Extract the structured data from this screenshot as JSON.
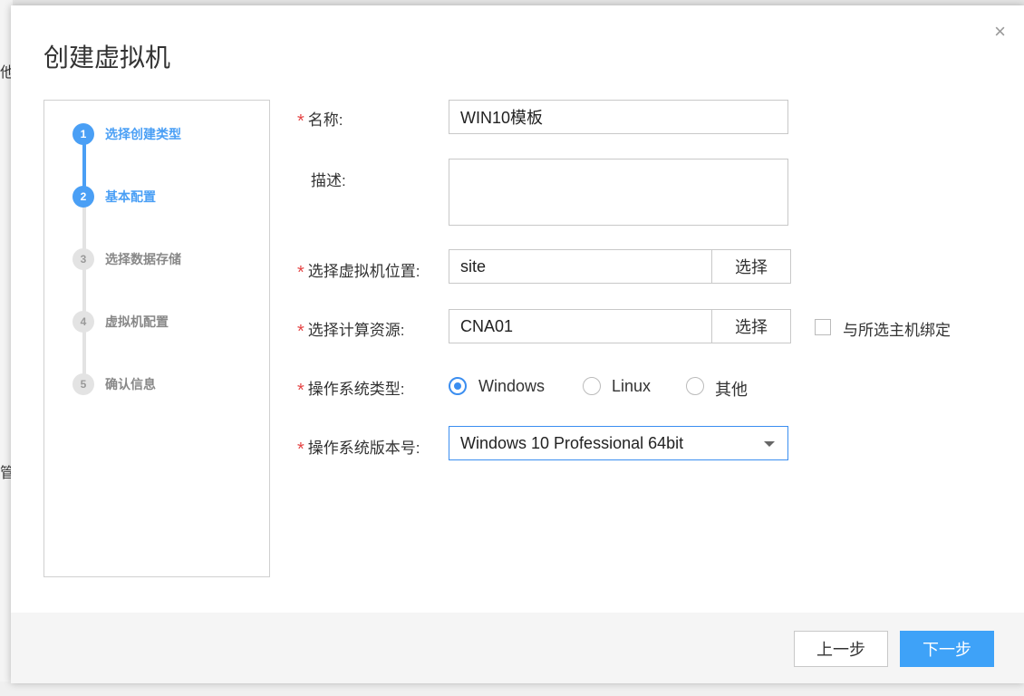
{
  "background": {
    "left_glyphs": [
      "他",
      "管"
    ]
  },
  "dialog": {
    "title": "创建虚拟机",
    "close_icon": "×"
  },
  "steps": [
    {
      "num": "1",
      "label": "选择创建类型",
      "state": "active"
    },
    {
      "num": "2",
      "label": "基本配置",
      "state": "active"
    },
    {
      "num": "3",
      "label": "选择数据存储",
      "state": "todo"
    },
    {
      "num": "4",
      "label": "虚拟机配置",
      "state": "todo"
    },
    {
      "num": "5",
      "label": "确认信息",
      "state": "todo"
    }
  ],
  "form": {
    "required_mark": "*",
    "name_label": "名称:",
    "name_value": "WIN10模板",
    "desc_label": "描述:",
    "desc_value": "",
    "location_label": "选择虚拟机位置:",
    "location_value": "site",
    "location_button": "选择",
    "compute_label": "选择计算资源:",
    "compute_value": "CNA01",
    "compute_button": "选择",
    "bind_label": "与所选主机绑定",
    "bind_checked": false,
    "os_type_label": "操作系统类型:",
    "os_type_options": [
      "Windows",
      "Linux",
      "其他"
    ],
    "os_type_selected": "Windows",
    "os_version_label": "操作系统版本号:",
    "os_version_value": "Windows 10 Professional 64bit"
  },
  "footer": {
    "prev_label": "上一步",
    "next_label": "下一步"
  },
  "colors": {
    "accent": "#3ea2f8",
    "step_active": "#4a9ff5",
    "required": "#e54545"
  }
}
